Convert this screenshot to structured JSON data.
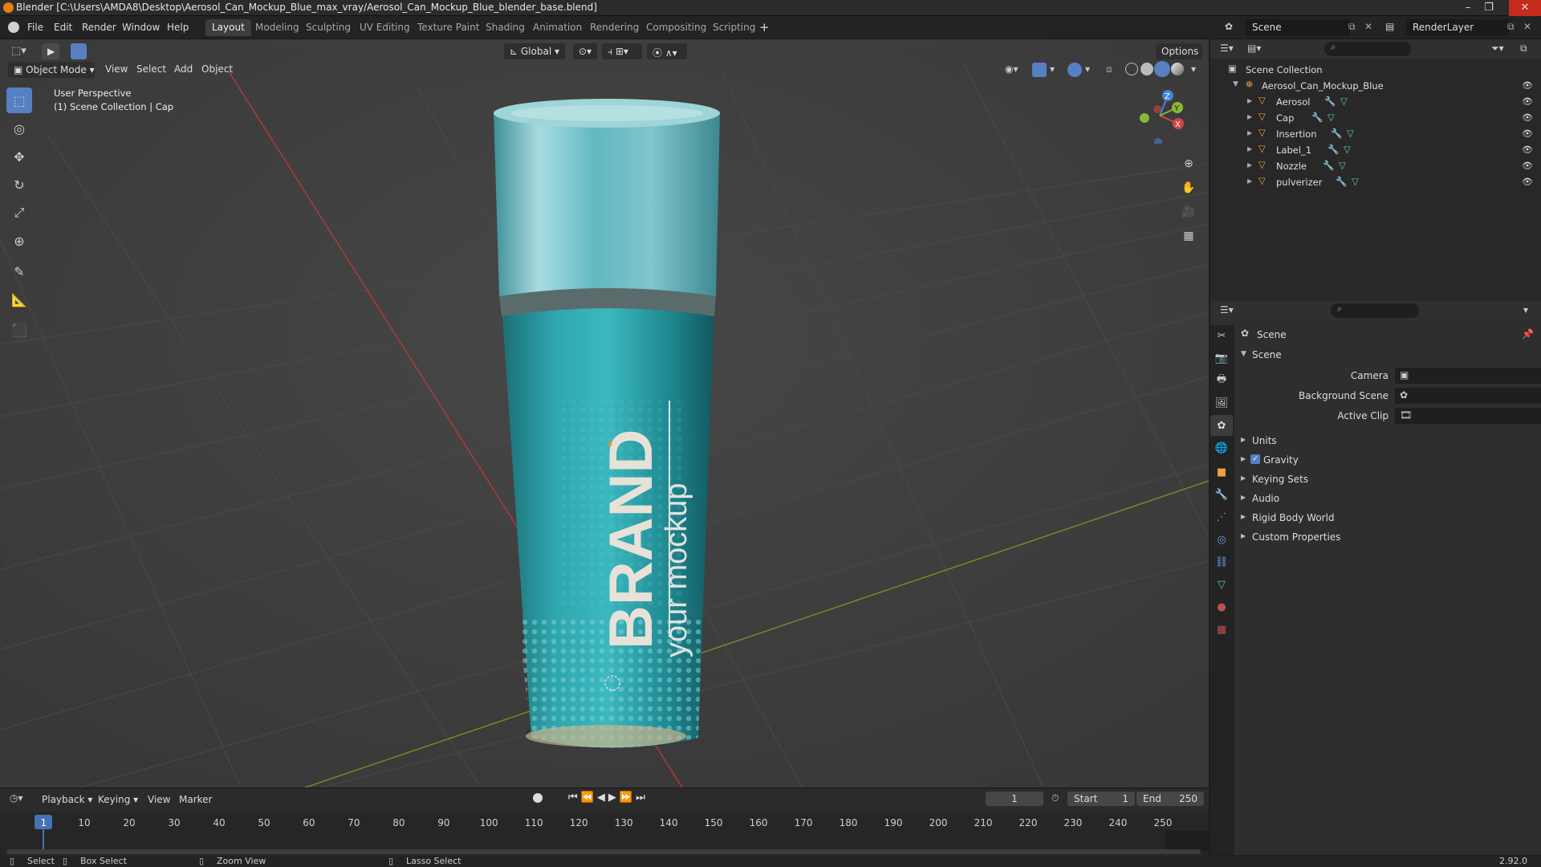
{
  "window": {
    "title": "Blender [C:\\Users\\AMDA8\\Desktop\\Aerosol_Can_Mockup_Blue_max_vray/Aerosol_Can_Mockup_Blue_blender_base.blend]",
    "btn_min": "–",
    "btn_max": "❐",
    "btn_close": "✕"
  },
  "menu": {
    "file": "File",
    "edit": "Edit",
    "render": "Render",
    "window": "Window",
    "help": "Help"
  },
  "workspaces": [
    "Layout",
    "Modeling",
    "Sculpting",
    "UV Editing",
    "Texture Paint",
    "Shading",
    "Animation",
    "Rendering",
    "Compositing",
    "Scripting"
  ],
  "workspace_add": "+",
  "scene_field": "Scene",
  "renderlayer_field": "RenderLayer",
  "viewport": {
    "mode": "Object Mode",
    "menus": [
      "View",
      "Select",
      "Add",
      "Object"
    ],
    "orientation": "Global",
    "options": "Options",
    "perspective": "User Perspective",
    "collection_info": "(1) Scene Collection | Cap",
    "can_brand": "BRAND",
    "can_sub": "your mockup",
    "gizmo_x": "X",
    "gizmo_y": "Y",
    "gizmo_z": "Z"
  },
  "outliner": {
    "root": "Scene Collection",
    "collection": "Aerosol_Can_Mockup_Blue",
    "objects": [
      "Aerosol",
      "Cap",
      "Insertion",
      "Label_1",
      "Nozzle",
      "pulverizer"
    ]
  },
  "properties": {
    "header": "Scene",
    "panel": "Scene",
    "camera_label": "Camera",
    "background_label": "Background Scene",
    "clip_label": "Active Clip",
    "sections": [
      "Units",
      "Gravity",
      "Keying Sets",
      "Audio",
      "Rigid Body World",
      "Custom Properties"
    ],
    "gravity_checked": true
  },
  "timeline": {
    "menus": [
      "Playback",
      "Keying",
      "View",
      "Marker"
    ],
    "current_frame": "1",
    "start_label": "Start",
    "start": "1",
    "end_label": "End",
    "end": "250",
    "ticks": [
      "1",
      "10",
      "20",
      "30",
      "40",
      "50",
      "60",
      "70",
      "80",
      "90",
      "100",
      "110",
      "120",
      "130",
      "140",
      "150",
      "160",
      "170",
      "180",
      "190",
      "200",
      "210",
      "220",
      "230",
      "240",
      "250"
    ]
  },
  "status": {
    "select": "Select",
    "box_select": "Box Select",
    "zoom_view": "Zoom View",
    "lasso_select": "Lasso Select",
    "version": "2.92.0"
  },
  "colors": {
    "accent": "#5680c2",
    "object_orange": "#e8a040",
    "grid_red": "#b33a3a",
    "grid_green": "#6a8f2a",
    "can_teal": "#2aa6b0"
  }
}
